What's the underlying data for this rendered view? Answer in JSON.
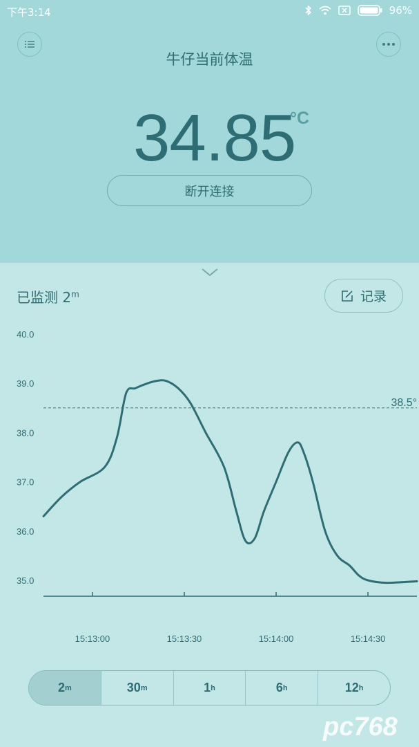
{
  "status_bar": {
    "time": "下午3:14",
    "battery": "96%"
  },
  "header": {
    "title": "牛仔当前体温",
    "menu_icon": "list-icon",
    "more_icon": "more-dots-icon"
  },
  "reading": {
    "value": "34.85",
    "unit": "°C"
  },
  "connection": {
    "disconnect_label": "断开连接"
  },
  "monitor": {
    "label": "已监测 2",
    "duration_unit": "m",
    "record_label": "记录"
  },
  "chart_data": {
    "type": "line",
    "x_tick_labels": [
      "15:13:00",
      "15:13:30",
      "15:14:00",
      "15:14:30"
    ],
    "y_tick_labels": [
      "40.0",
      "39.0",
      "38.0",
      "37.0",
      "36.0",
      "35.0"
    ],
    "ylim": [
      35.0,
      40.0
    ],
    "xlim": [
      "15:12:44",
      "15:14:46"
    ],
    "threshold": {
      "value": 38.5,
      "label": "38.5°"
    },
    "series": [
      {
        "x": [
          "15:12:44",
          "15:12:50",
          "15:12:56",
          "15:13:04",
          "15:13:08",
          "15:13:11",
          "15:13:14",
          "15:13:18",
          "15:13:21",
          "15:13:24",
          "15:13:28",
          "15:13:32",
          "15:13:37",
          "15:13:43",
          "15:13:47",
          "15:13:50",
          "15:13:53",
          "15:13:56",
          "15:14:00",
          "15:14:04",
          "15:14:07",
          "15:14:09",
          "15:14:12",
          "15:14:16",
          "15:14:20",
          "15:14:24",
          "15:14:27",
          "15:14:30",
          "15:14:36",
          "15:14:46"
        ],
        "y": [
          36.3,
          36.7,
          37.0,
          37.3,
          37.9,
          38.8,
          38.9,
          39.0,
          39.05,
          39.05,
          38.9,
          38.6,
          38.0,
          37.3,
          36.4,
          35.8,
          35.85,
          36.4,
          37.0,
          37.6,
          37.8,
          37.6,
          37.0,
          36.0,
          35.5,
          35.3,
          35.1,
          35.0,
          34.95,
          34.98
        ]
      }
    ]
  },
  "range_tabs": [
    {
      "value": "2",
      "unit": "m"
    },
    {
      "value": "30",
      "unit": "m"
    },
    {
      "value": "1",
      "unit": "h"
    },
    {
      "value": "6",
      "unit": "h"
    },
    {
      "value": "12",
      "unit": "h"
    }
  ],
  "colors": {
    "header_bg": "#a2d8d9",
    "body_bg": "#c3e6e6",
    "accent": "#2f6d75",
    "line": "#2f6d75"
  },
  "watermark": "pc768"
}
